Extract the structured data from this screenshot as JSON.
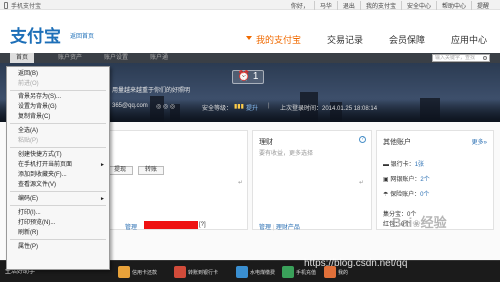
{
  "topbar": {
    "phone_label": "手机支付宝",
    "links": [
      "你好，",
      "马华",
      "退出",
      "我的支付宝",
      "安全中心",
      "帮助中心",
      "提醒"
    ]
  },
  "header": {
    "logo": "支付宝",
    "logo_sub": "返回首页",
    "nav": [
      "我的支付宝",
      "交易记录",
      "会员保障",
      "应用中心"
    ],
    "active_nav": 0
  },
  "tabstrip": {
    "tabs": [
      "首页",
      "账户资产",
      "账户设置",
      "账户通"
    ],
    "search_placeholder": "输入关键字，查找"
  },
  "banner": {
    "notice": "用量越来越重于你们的好照明",
    "clock_value": "1"
  },
  "userinfo": {
    "email": "365@qq.com",
    "security_label": "安全等级：",
    "security_value": "提升",
    "last_login": "上次登录时间：2014.01.25 18:08:14"
  },
  "panels": {
    "left": {
      "btn_recharge": "提现",
      "btn_transfer": "转账",
      "manage_link": "管理",
      "manage_extra": "[?]"
    },
    "middle": {
      "title": "理财",
      "subtitle": "要有收益，更多选择",
      "links": [
        "管理",
        "理财产品"
      ]
    },
    "right": {
      "title": "其他账户",
      "more": "更多»",
      "rows": [
        {
          "label": "银行卡：",
          "value": "1张"
        },
        {
          "label": "网银账户：",
          "value": "2个"
        },
        {
          "label": "保险账户：",
          "value": "0个"
        }
      ],
      "extras": [
        "集分宝：0个",
        "红包：0个"
      ]
    }
  },
  "context_menu": {
    "items": [
      {
        "label": "返回(B)",
        "disabled": false,
        "submenu": false
      },
      {
        "label": "前进(O)",
        "disabled": true,
        "submenu": false
      },
      {
        "sep": true
      },
      {
        "label": "背景另存为(S)...",
        "disabled": false,
        "submenu": false
      },
      {
        "label": "设置为背景(G)",
        "disabled": false,
        "submenu": false
      },
      {
        "label": "复制背景(C)",
        "disabled": false,
        "submenu": false
      },
      {
        "sep": true
      },
      {
        "label": "全选(A)",
        "disabled": false,
        "submenu": false
      },
      {
        "label": "粘贴(P)",
        "disabled": true,
        "submenu": false
      },
      {
        "sep": true
      },
      {
        "label": "创建快捷方式(T)",
        "disabled": false,
        "submenu": false
      },
      {
        "label": "在手机打开当前页面",
        "disabled": false,
        "submenu": true
      },
      {
        "label": "添加到收藏夹(F)...",
        "disabled": false,
        "submenu": false
      },
      {
        "label": "查看源文件(V)",
        "disabled": false,
        "submenu": false
      },
      {
        "sep": true
      },
      {
        "label": "编码(E)",
        "disabled": false,
        "submenu": true
      },
      {
        "sep": true
      },
      {
        "label": "打印(I)...",
        "disabled": false,
        "submenu": false
      },
      {
        "label": "打印预览(N)...",
        "disabled": false,
        "submenu": false
      },
      {
        "label": "刷新(R)",
        "disabled": false,
        "submenu": false
      },
      {
        "sep": true
      },
      {
        "label": "属性(P)",
        "disabled": false,
        "submenu": false
      }
    ]
  },
  "taskbar": {
    "start_label": "生活好助手",
    "buttons": [
      {
        "label": "信用卡还款",
        "color": "#e8a23a"
      },
      {
        "label": "转账到银行卡",
        "color": "#d14b3a"
      },
      {
        "label": "水电煤缴费",
        "color": "#3a8fd1"
      },
      {
        "label": "手机充值",
        "color": "#3aa15a"
      },
      {
        "label": "我的",
        "color": "#e0703a"
      }
    ]
  },
  "watermark": {
    "text1": "Bai",
    "text2": "经验",
    "url": "https://blog.csdn.net/qq"
  },
  "colors": {
    "accent": "#f06a00",
    "brand": "#1d6fb8",
    "link": "#2a6fb3"
  }
}
